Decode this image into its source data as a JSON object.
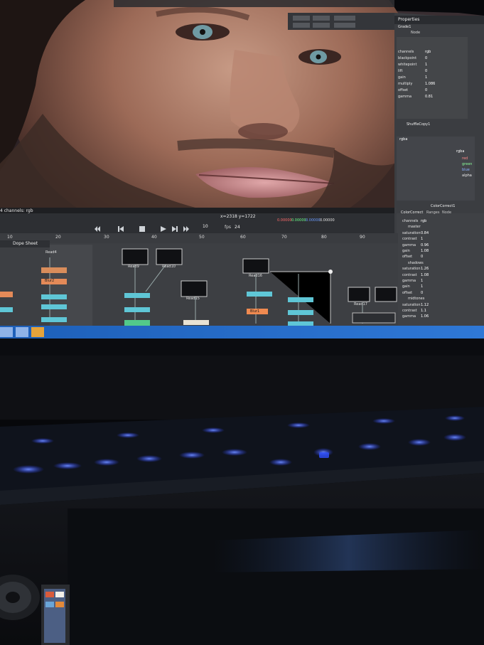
{
  "viewer": {
    "status_left": "4 channels: rgb",
    "coords": "x=2318 y=1722",
    "values": [
      "0.00000",
      "0.00000",
      "0.00000",
      "0.00000"
    ],
    "frame": "10",
    "fps_label": "fps",
    "fps_value": "24"
  },
  "timeline": {
    "ticks": [
      "10",
      "20",
      "30",
      "40",
      "50",
      "60",
      "70",
      "80",
      "90"
    ]
  },
  "node_graph": {
    "tab": "Dope Sheet",
    "nodes": [
      "Read4",
      "Read9",
      "Read10",
      "Read16",
      "Read17",
      "Read15",
      "Read18",
      "Blur1",
      "Blur2",
      "ColorCorrect1",
      "Grade1",
      "Dot1"
    ]
  },
  "properties": {
    "title": "Properties",
    "grade_node": "Grade1",
    "grade_tab": "Node",
    "grade_params": [
      "channels",
      "blackpoint",
      "whitepoint",
      "lift",
      "gain",
      "multiply",
      "offset",
      "gamma"
    ],
    "grade_values": [
      "rgb",
      "0",
      "1",
      "0",
      "1",
      "1.086",
      "0",
      "0.81"
    ],
    "shuffle_node": "ShuffleCopy1",
    "shuffle_channels": [
      "rgba",
      "rgba",
      "red",
      "green",
      "blue",
      "alpha"
    ],
    "cc_node": "ColorCorrect1",
    "cc_tabs": [
      "ColorCorrect",
      "Ranges",
      "Node"
    ],
    "cc_rows": [
      {
        "label": "channels",
        "value": "rgb"
      },
      {
        "label": "master",
        "value": ""
      },
      {
        "label": "saturation",
        "value": "0.84"
      },
      {
        "label": "contrast",
        "value": "1"
      },
      {
        "label": "gamma",
        "value": "0.96"
      },
      {
        "label": "gain",
        "value": "1.08"
      },
      {
        "label": "offset",
        "value": "0"
      },
      {
        "label": "shadows",
        "value": ""
      },
      {
        "label": "saturation",
        "value": "1.26"
      },
      {
        "label": "contrast",
        "value": "1.08"
      },
      {
        "label": "gamma",
        "value": "1"
      },
      {
        "label": "gain",
        "value": "1"
      },
      {
        "label": "offset",
        "value": "0"
      },
      {
        "label": "midtones",
        "value": ""
      },
      {
        "label": "saturation",
        "value": "1.12"
      },
      {
        "label": "contrast",
        "value": "1.1"
      },
      {
        "label": "gamma",
        "value": "1.06"
      }
    ]
  },
  "icons": [
    "play-icon",
    "stop-icon",
    "step-forward-icon",
    "step-back-icon",
    "rewind-icon",
    "fast-forward-icon",
    "keyboard-key-icon",
    "speaker-icon"
  ],
  "colors": {
    "accent": "#2f6fd6",
    "highlight_node": "#ff8a3d",
    "key_glow": "#3b6dff",
    "ui_panel": "#3a3c40"
  }
}
